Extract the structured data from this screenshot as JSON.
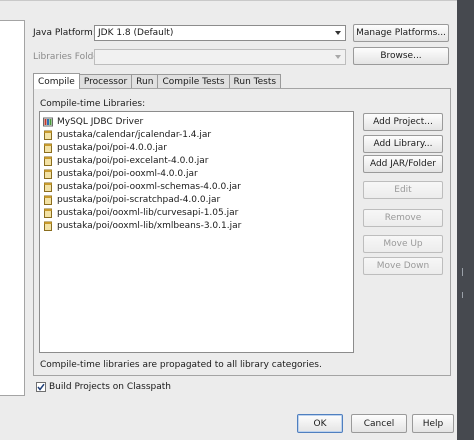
{
  "platform": {
    "label": "Java Platform:",
    "value": "JDK 1.8 (Default)",
    "manage_button": "Manage Platforms..."
  },
  "libraries_folder": {
    "label": "Libraries Folder:",
    "value": "",
    "browse_button": "Browse..."
  },
  "tabs": [
    {
      "label": "Compile",
      "active": true
    },
    {
      "label": "Processor",
      "active": false
    },
    {
      "label": "Run",
      "active": false
    },
    {
      "label": "Compile Tests",
      "active": false
    },
    {
      "label": "Run Tests",
      "active": false
    }
  ],
  "compile": {
    "list_label": "Compile-time Libraries:",
    "items": [
      {
        "label": "MySQL JDBC Driver",
        "icon": "library-icon"
      },
      {
        "label": "pustaka/calendar/jcalendar-1.4.jar",
        "icon": "jar-icon"
      },
      {
        "label": "pustaka/poi/poi-4.0.0.jar",
        "icon": "jar-icon"
      },
      {
        "label": "pustaka/poi/poi-excelant-4.0.0.jar",
        "icon": "jar-icon"
      },
      {
        "label": "pustaka/poi/poi-ooxml-4.0.0.jar",
        "icon": "jar-icon"
      },
      {
        "label": "pustaka/poi/poi-ooxml-schemas-4.0.0.jar",
        "icon": "jar-icon"
      },
      {
        "label": "pustaka/poi/poi-scratchpad-4.0.0.jar",
        "icon": "jar-icon"
      },
      {
        "label": "pustaka/poi/ooxml-lib/curvesapi-1.05.jar",
        "icon": "jar-icon"
      },
      {
        "label": "pustaka/poi/ooxml-lib/xmlbeans-3.0.1.jar",
        "icon": "jar-icon"
      }
    ],
    "buttons": {
      "add_project": "Add Project...",
      "add_library": "Add Library...",
      "add_jar": "Add JAR/Folder",
      "edit": "Edit",
      "remove": "Remove",
      "move_up": "Move Up",
      "move_down": "Move Down"
    },
    "note": "Compile-time libraries are propagated to all library categories."
  },
  "build_on_classpath": {
    "label": "Build Projects on Classpath",
    "checked": true
  },
  "dialog_buttons": {
    "ok": "OK",
    "cancel": "Cancel",
    "help": "Help"
  }
}
